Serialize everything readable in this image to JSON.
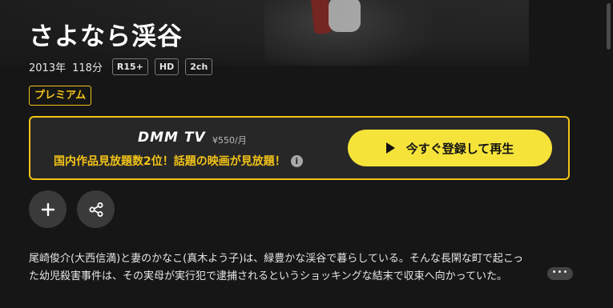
{
  "title": "さよなら渓谷",
  "meta": {
    "year": "2013年",
    "duration": "118分",
    "badges": [
      "R15+",
      "HD",
      "2ch"
    ]
  },
  "plan_badge": "プレミアム",
  "dmm": {
    "logo": "DMM TV",
    "price": "¥550/月",
    "promo": "国内作品見放題数2位！話題の映画が見放題！",
    "cta_label": "今すぐ登録して再生"
  },
  "icons": {
    "info": "info-icon",
    "play": "play-icon",
    "add": "plus-icon",
    "share": "share-icon",
    "more": "ellipsis-icon"
  },
  "synopsis": {
    "line1": "尾崎俊介(大西信満)と妻のかなこ(真木よう子)は、緑豊かな渓谷で暮らしている。そんな長閑な町で起こっ",
    "line2": "た幼児殺害事件は、その実母が実行犯で逮捕されるというショッキングな結末で収束へ向かっていた。",
    "more_label": "•••"
  },
  "colors": {
    "accent": "#f2c318",
    "cta": "#f5e33a",
    "background": "#161616"
  }
}
